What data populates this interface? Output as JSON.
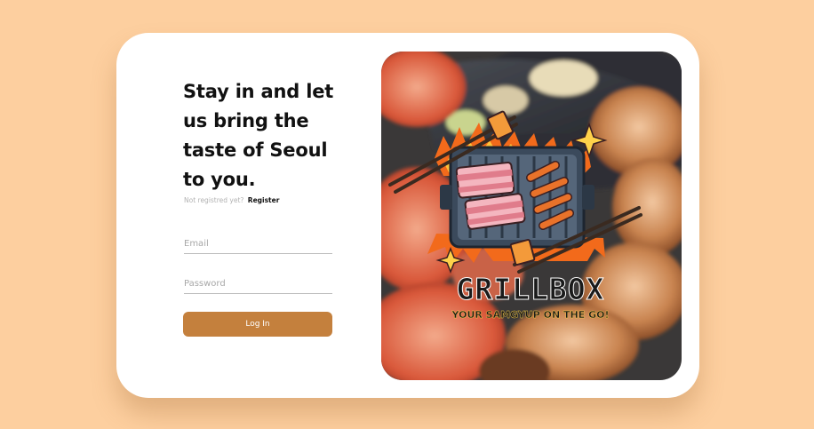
{
  "login": {
    "headline": "Stay in and let us bring the taste of Seoul to you.",
    "not_registered_text": "Not registred yet?",
    "register_link": "Register",
    "email_placeholder": "Email",
    "password_placeholder": "Password",
    "login_button": "Log In"
  },
  "brand": {
    "name": "GRILLBOX",
    "tagline": "YOUR SAMGYUP ON THE GO!"
  },
  "colors": {
    "page_background": "#fdcf9f",
    "button": "#c4803d",
    "card": "#ffffff"
  },
  "icons": {
    "logo": "grill-with-pork-belly-and-chopsticks"
  }
}
